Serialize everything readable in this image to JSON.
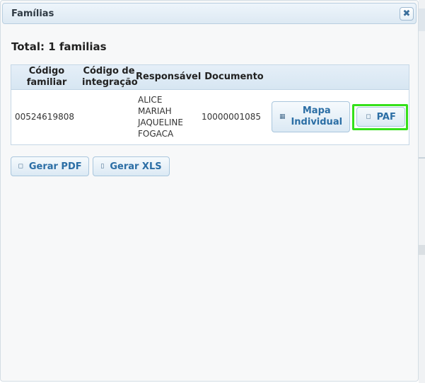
{
  "dialog": {
    "title": "Famílias",
    "close_icon": "close-icon"
  },
  "summary": {
    "total_text": "Total: 1 familias"
  },
  "table": {
    "headers": {
      "codigo_familiar_l1": "Código",
      "codigo_familiar_l2": "familiar",
      "codigo_integracao_l1": "Código de",
      "codigo_integracao_l2": "integração",
      "responsavel": "Responsável",
      "documento": "Documento"
    },
    "rows": [
      {
        "codigo_familiar": "00524619808",
        "codigo_integracao": "",
        "responsavel_lines": [
          "ALICE",
          "MARIAH",
          "JAQUELINE",
          "FOGACA"
        ],
        "documento": "10000001085",
        "mapa_label_l1": "Mapa",
        "mapa_label_l2": "Individual",
        "paf_label": "PAF"
      }
    ]
  },
  "actions": {
    "gerar_pdf": "Gerar PDF",
    "gerar_xls": "Gerar XLS"
  },
  "icons": {
    "mapa": "book-icon",
    "paf": "document-icon",
    "pdf": "document-icon",
    "xls": "spreadsheet-icon"
  },
  "colors": {
    "accent_text": "#2b6ea5",
    "focus_highlight": "#35e01a",
    "header_bg": "#dde9f3"
  }
}
